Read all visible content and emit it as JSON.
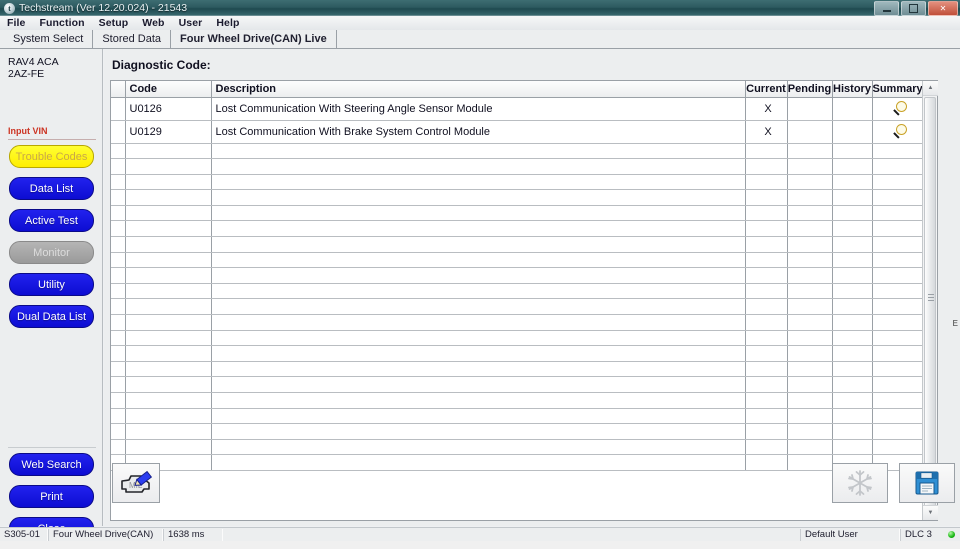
{
  "window": {
    "title": "Techstream (Ver 12.20.024) - 21543",
    "app_icon": "techstream-logo-icon",
    "minimize_label": "Minimize",
    "maximize_label": "Maximize",
    "close_label": "✕"
  },
  "menu": {
    "items": [
      "File",
      "Function",
      "Setup",
      "Web",
      "User",
      "Help"
    ]
  },
  "tabs": [
    {
      "label": "System Select",
      "active": false
    },
    {
      "label": "Stored Data",
      "active": false
    },
    {
      "label": "Four Wheel Drive(CAN) Live",
      "active": true
    }
  ],
  "sidebar": {
    "vehicle_line1": "RAV4 ACA",
    "vehicle_line2": "2AZ-FE",
    "vin_link": "Input VIN",
    "buttons": [
      {
        "label": "Trouble Codes",
        "state": "selected"
      },
      {
        "label": "Data List",
        "state": "normal"
      },
      {
        "label": "Active Test",
        "state": "normal"
      },
      {
        "label": "Monitor",
        "state": "disabled"
      },
      {
        "label": "Utility",
        "state": "normal"
      },
      {
        "label": "Dual Data List",
        "state": "normal"
      }
    ],
    "bottom_buttons": [
      {
        "label": "Web Search"
      },
      {
        "label": "Print"
      },
      {
        "label": "Close"
      }
    ]
  },
  "main": {
    "title": "Diagnostic Code:",
    "columns": [
      "Code",
      "Description",
      "Current",
      "Pending",
      "History",
      "Summary"
    ],
    "rows": [
      {
        "code": "U0126",
        "description": "Lost Communication With Steering Angle Sensor Module",
        "current": "X",
        "pending": "",
        "history": "",
        "summary_icon": "magnifier-icon"
      },
      {
        "code": "U0129",
        "description": "Lost Communication With Brake System Control Module",
        "current": "X",
        "pending": "",
        "history": "",
        "summary_icon": "magnifier-icon"
      }
    ],
    "empty_row_count": 21,
    "scroll_up_glyph": "▲",
    "scroll_down_glyph": "▼",
    "scroll_marker": "E"
  },
  "toolbar": {
    "mil_button_label": "MIL check / edit",
    "mil_icon": "engine-pencil-icon",
    "freeze_button_label": "Freeze Frame Data",
    "freeze_icon": "snowflake-icon",
    "save_button_label": "Save",
    "save_icon": "floppy-disk-icon"
  },
  "statusbar": {
    "code": "S305-01",
    "system": "Four Wheel Drive(CAN)",
    "timing": "1638 ms",
    "user": "Default User",
    "connection": "DLC 3",
    "led": "connected-led"
  },
  "colors": {
    "accent_blue": "#1414e0",
    "selected_yellow": "#ffee00",
    "vin_red": "#cc3322",
    "titlebar_teal": "#2d5a60",
    "led_green": "#19b814"
  }
}
